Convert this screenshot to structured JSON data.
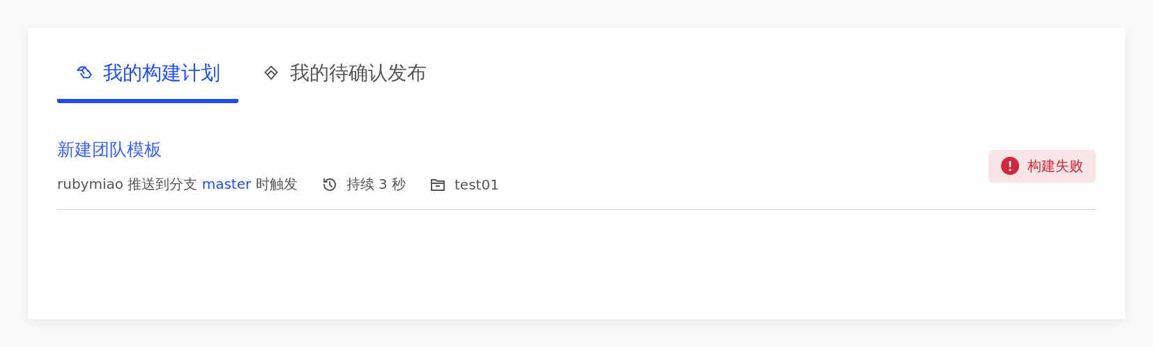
{
  "tabs": [
    {
      "label": "我的构建计划",
      "selected": true
    },
    {
      "label": "我的待确认发布",
      "selected": false
    }
  ],
  "builds": [
    {
      "title": "新建团队模板",
      "user": "rubymiao",
      "action": "推送到分支",
      "branch": "master",
      "suffix": "时触发",
      "duration": "持续 3 秒",
      "project": "test01",
      "status": {
        "kind": "failed",
        "label": "构建失败"
      }
    }
  ]
}
